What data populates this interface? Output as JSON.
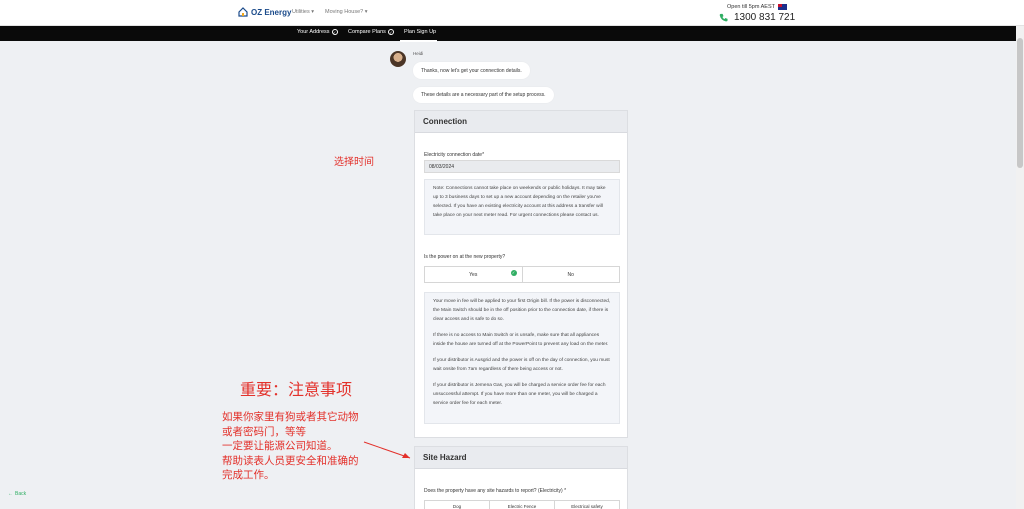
{
  "header": {
    "brand": "OZ Energy",
    "nav": [
      {
        "label": "Utilities"
      },
      {
        "label": "Moving House?"
      }
    ],
    "hours": "Open till 5pm AEST",
    "phone": "1300 831 721"
  },
  "steps": [
    {
      "label": "Your Address",
      "done": true
    },
    {
      "label": "Compare Plans",
      "done": true
    },
    {
      "label": "Plan Sign Up",
      "active": true
    }
  ],
  "chat": {
    "agent_name": "Heidi",
    "messages": [
      "Thanks, now let's get your connection details.",
      "These details are a necessary part of the setup process."
    ]
  },
  "connection": {
    "title": "Connection",
    "date_label": "Electricity connection date*",
    "date_value": "08/03/2024",
    "note": "Note: Connections cannot take place on weekends or public holidays. It may take up to 3 business days to set up a new account depending on the retailer you've selected. If you have an existing electricity account at this address a transfer will take place on your next meter read. For urgent connections please contact us.",
    "power_question": "Is the power on at the new property?",
    "power_options": [
      "Yes",
      "No"
    ],
    "power_selected": "Yes",
    "info": [
      "Your move in fee will be applied to your first Origin bill. If the power is disconnected, the Main Switch should be in the off position prior to the connection date, if there is clear access and is safe to do so.",
      "If there is no access to Main Switch or is unsafe, make sure that all appliances inside the house are turned off at the PowerPoint to prevent any load on the meter.",
      "If your distributor is Ausgrid and the power is off on the day of connection, you must wait onsite from 7am regardless of there being access or not.",
      "If your distributor is Jemena Gas, you will be charged a service order fee for each unsuccessful attempt. If you have more than one meter, you will be charged a service order fee for each meter."
    ]
  },
  "site_hazard": {
    "title": "Site Hazard",
    "question": "Does the property have any site hazards to report? (Electricity) *",
    "options": [
      "Dog",
      "Electric Fence",
      "Electrical safety"
    ]
  },
  "annotations": {
    "select_time": "选择时间",
    "important_title": "重要：注意事项",
    "lines": [
      "如果你家里有狗或者其它动物",
      "或者密码门，等等",
      "一定要让能源公司知道。",
      "帮助读表人员更安全和准确的",
      "完成工作。"
    ]
  },
  "back_label": "Back",
  "colors": {
    "brand": "#1a4a8a",
    "accent_green": "#2fae63",
    "annotation_red": "#e3312b",
    "step_bar": "#0a0a0a"
  }
}
